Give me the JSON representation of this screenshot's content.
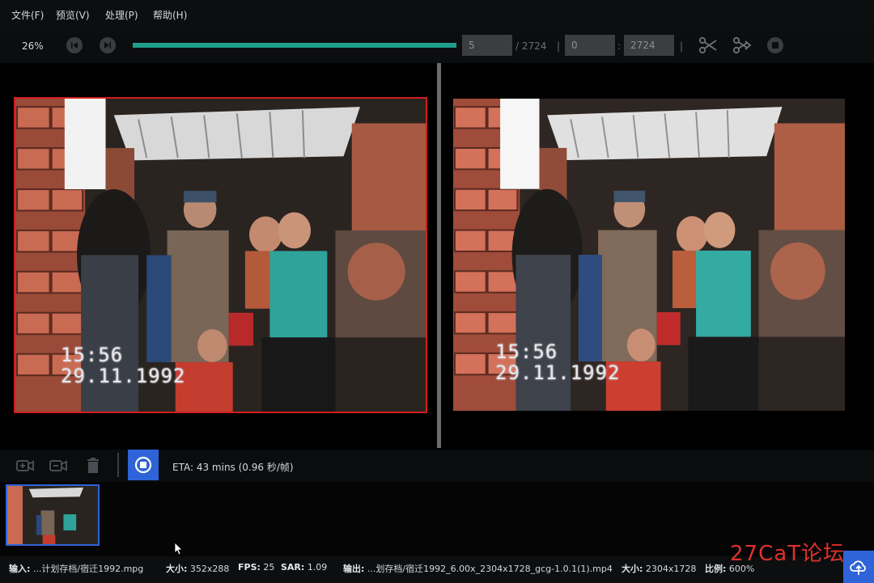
{
  "menu": [
    "文件(F)",
    "预览(V)",
    "处理(P)",
    "帮助(H)"
  ],
  "toolbar": {
    "zoom": "26%",
    "progress": 1.0,
    "current_frame": "5",
    "total_frames": "/ 2724",
    "range_sep_1": "|",
    "range_start": "0",
    "range_sep_2": ":",
    "range_end": "2724",
    "range_sep_3": "|"
  },
  "preview": {
    "left_timestamp_time": "15:56",
    "left_timestamp_date": "29.11.1992",
    "right_timestamp_time": "15:56",
    "right_timestamp_date": "29.11.1992"
  },
  "process": {
    "eta": "ETA:  43 mins  (0.96 秒/帧)"
  },
  "status": {
    "input_label": "输入:",
    "input_value": "...计划存档/宿迁1992.mpg",
    "size_label": "大小:",
    "size_value": "352x288",
    "fps_label": "FPS:",
    "fps_value": "25",
    "sar_label": "SAR:",
    "sar_value": "1.09",
    "output_label": "输出:",
    "output_value": "...划存档/宿迁1992_6.00x_2304x1728_gcg-1.0.1(1).mp4",
    "out_size_label": "大小:",
    "out_size_value": "2304x1728",
    "ratio_label": "比例:",
    "ratio_value": "600%"
  },
  "watermark": "27CaT论坛",
  "colors": {
    "accent": "#2f63d8",
    "progress": "#1e9e8a",
    "selection": "#d01e1e"
  }
}
